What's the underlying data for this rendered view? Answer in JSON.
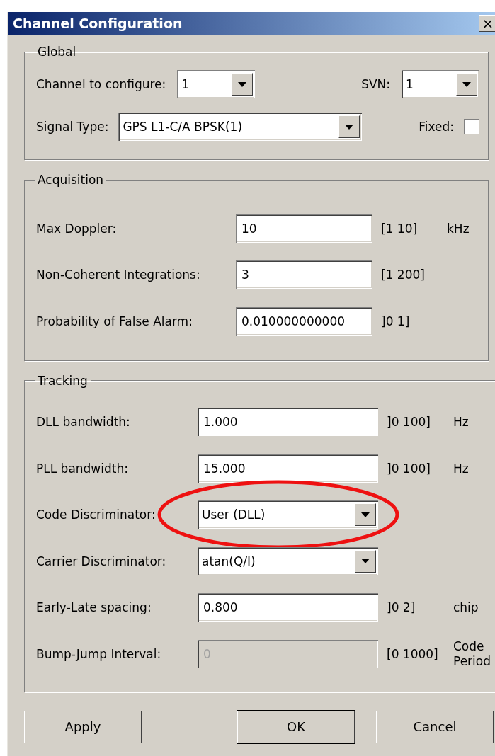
{
  "window": {
    "title": "Channel Configuration",
    "close": "×"
  },
  "global": {
    "title": "Global",
    "channel": {
      "label": "Channel to configure:",
      "value": "1"
    },
    "svn": {
      "label": "SVN:",
      "value": "1"
    },
    "signal": {
      "label": "Signal Type:",
      "value": "GPS L1-C/A BPSK(1)"
    },
    "fixed": {
      "label": "Fixed:",
      "checked": false
    }
  },
  "acquisition": {
    "title": "Acquisition",
    "rows": [
      {
        "label": "Max Doppler:",
        "kind": "text",
        "value": "10",
        "range": "[1 10]",
        "unit": "kHz",
        "disabled": false
      },
      {
        "label": "Non-Coherent Integrations:",
        "kind": "text",
        "value": "3",
        "range": "[1 200]",
        "disabled": false
      },
      {
        "label": "Probability of False Alarm:",
        "kind": "text",
        "value": "0.010000000000",
        "range": "]0 1]",
        "disabled": false
      }
    ]
  },
  "tracking": {
    "title": "Tracking",
    "rows": [
      {
        "label": "DLL bandwidth:",
        "kind": "text",
        "value": "1.000",
        "range": "]0 100]",
        "unit": "Hz",
        "disabled": false
      },
      {
        "label": "PLL bandwidth:",
        "kind": "text",
        "value": "15.000",
        "range": "]0 100]",
        "unit": "Hz",
        "disabled": false
      },
      {
        "label": "Code Discriminator:",
        "kind": "dropdown",
        "value": "User (DLL)",
        "highlighted": true
      },
      {
        "label": "Carrier Discriminator:",
        "kind": "dropdown",
        "value": "atan(Q/I)"
      },
      {
        "label": "Early-Late spacing:",
        "kind": "text",
        "value": "0.800",
        "range": "]0 2]",
        "unit": "chip",
        "disabled": false
      },
      {
        "label": "Bump-Jump Interval:",
        "kind": "text",
        "value": "0",
        "range": "[0 1000]",
        "unit": "Code Period",
        "disabled": true
      }
    ]
  },
  "buttons": [
    {
      "label": "Apply",
      "default": false
    },
    {
      "label": "OK",
      "default": true
    },
    {
      "label": "Cancel",
      "default": false
    }
  ]
}
